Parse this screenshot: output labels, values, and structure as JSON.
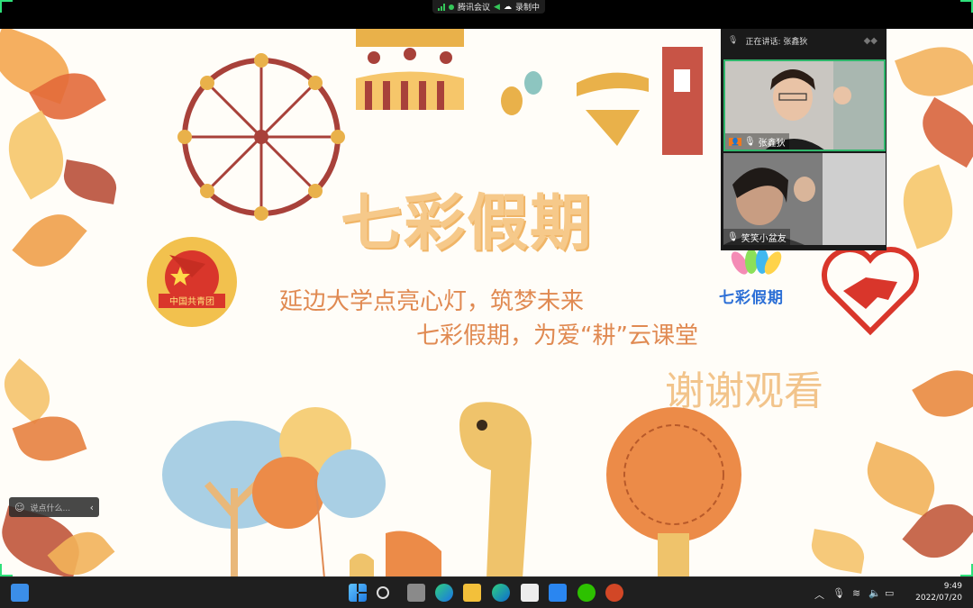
{
  "meeting_bar": {
    "app_name": "腾讯会议",
    "recording_label": "录制中"
  },
  "slide": {
    "title": "七彩假期",
    "line1": "延边大学点亮心灯，筑梦未来",
    "line2": "七彩假期，为爱“耕”云课堂",
    "thanks": "谢谢观看",
    "logo_text": "七彩假期",
    "badge_text": "中国共青团"
  },
  "chat": {
    "placeholder": "说点什么..."
  },
  "video_panel": {
    "speaking_label": "正在讲话: 张鑫狄",
    "participants": [
      {
        "name": "张鑫狄"
      },
      {
        "name": "笑笑小盆友"
      }
    ]
  },
  "taskbar": {
    "time": "9:49",
    "date": "2022/07/20"
  },
  "colors": {
    "accent_green": "#2fe07a",
    "title_orange": "#f6c98a",
    "text_orange": "#e08a52"
  }
}
